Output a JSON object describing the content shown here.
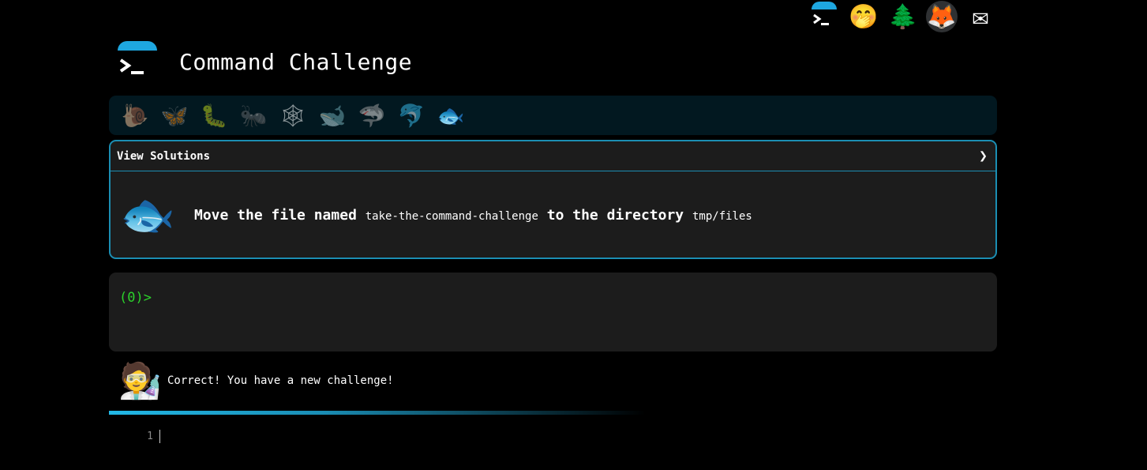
{
  "top_nav": {
    "items": [
      {
        "name": "logo",
        "glyph": ">_"
      },
      {
        "name": "hint",
        "glyph": "🤭"
      },
      {
        "name": "tree",
        "glyph": "🌲"
      },
      {
        "name": "gitlab",
        "glyph": "🦊"
      },
      {
        "name": "mail",
        "glyph": "✉"
      }
    ]
  },
  "header": {
    "logo_glyph": ">_",
    "title": "Command Challenge"
  },
  "levels": [
    {
      "glyph": "🐌",
      "current": false
    },
    {
      "glyph": "🦋",
      "current": false
    },
    {
      "glyph": "🐛",
      "current": false
    },
    {
      "glyph": "🐜",
      "current": false
    },
    {
      "glyph": "🕸",
      "current": false
    },
    {
      "glyph": "🐋",
      "current": false
    },
    {
      "glyph": "🦈",
      "current": false
    },
    {
      "glyph": "🐬",
      "current": false
    },
    {
      "glyph": "🐟",
      "current": true
    }
  ],
  "challenge": {
    "solutions_label": "View Solutions",
    "chevron": "❯",
    "fish_glyph": "🐟",
    "text_part1": "Move the file named ",
    "file_name": "take-the-command-challenge",
    "text_part2": " to the directory ",
    "dir_name": "tmp/files"
  },
  "terminal": {
    "prompt": "(0)>"
  },
  "feedback": {
    "avatar_glyph": "🧑‍🔬",
    "message": "Correct! You have a new challenge!"
  },
  "progress": {
    "fraction": 0.47
  },
  "editor": {
    "line_number": "1"
  },
  "colors": {
    "accent": "#1ea7e0",
    "border": "#1b8eb3",
    "prompt": "#2bd12b",
    "panel": "#1c1c1c",
    "level_bar": "#021820"
  }
}
